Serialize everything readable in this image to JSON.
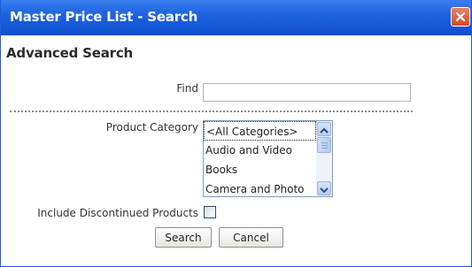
{
  "window": {
    "title": "Master Price List - Search",
    "close_icon": "close-icon",
    "accent_color": "#1f63e0",
    "close_color": "#d24a2c"
  },
  "form": {
    "heading": "Advanced Search",
    "find": {
      "label": "Find",
      "value": "",
      "placeholder": ""
    },
    "category": {
      "label": "Product Category",
      "options": [
        "<All Categories>",
        "Audio and Video",
        "Books",
        "Camera and Photo"
      ],
      "selected": "<All Categories>",
      "scroll_up_icon": "chevron-up-icon",
      "scroll_down_icon": "chevron-down-icon"
    },
    "discontinued": {
      "label": "Include Discontinued Products",
      "checked": false
    },
    "buttons": {
      "search": "Search",
      "cancel": "Cancel"
    }
  }
}
